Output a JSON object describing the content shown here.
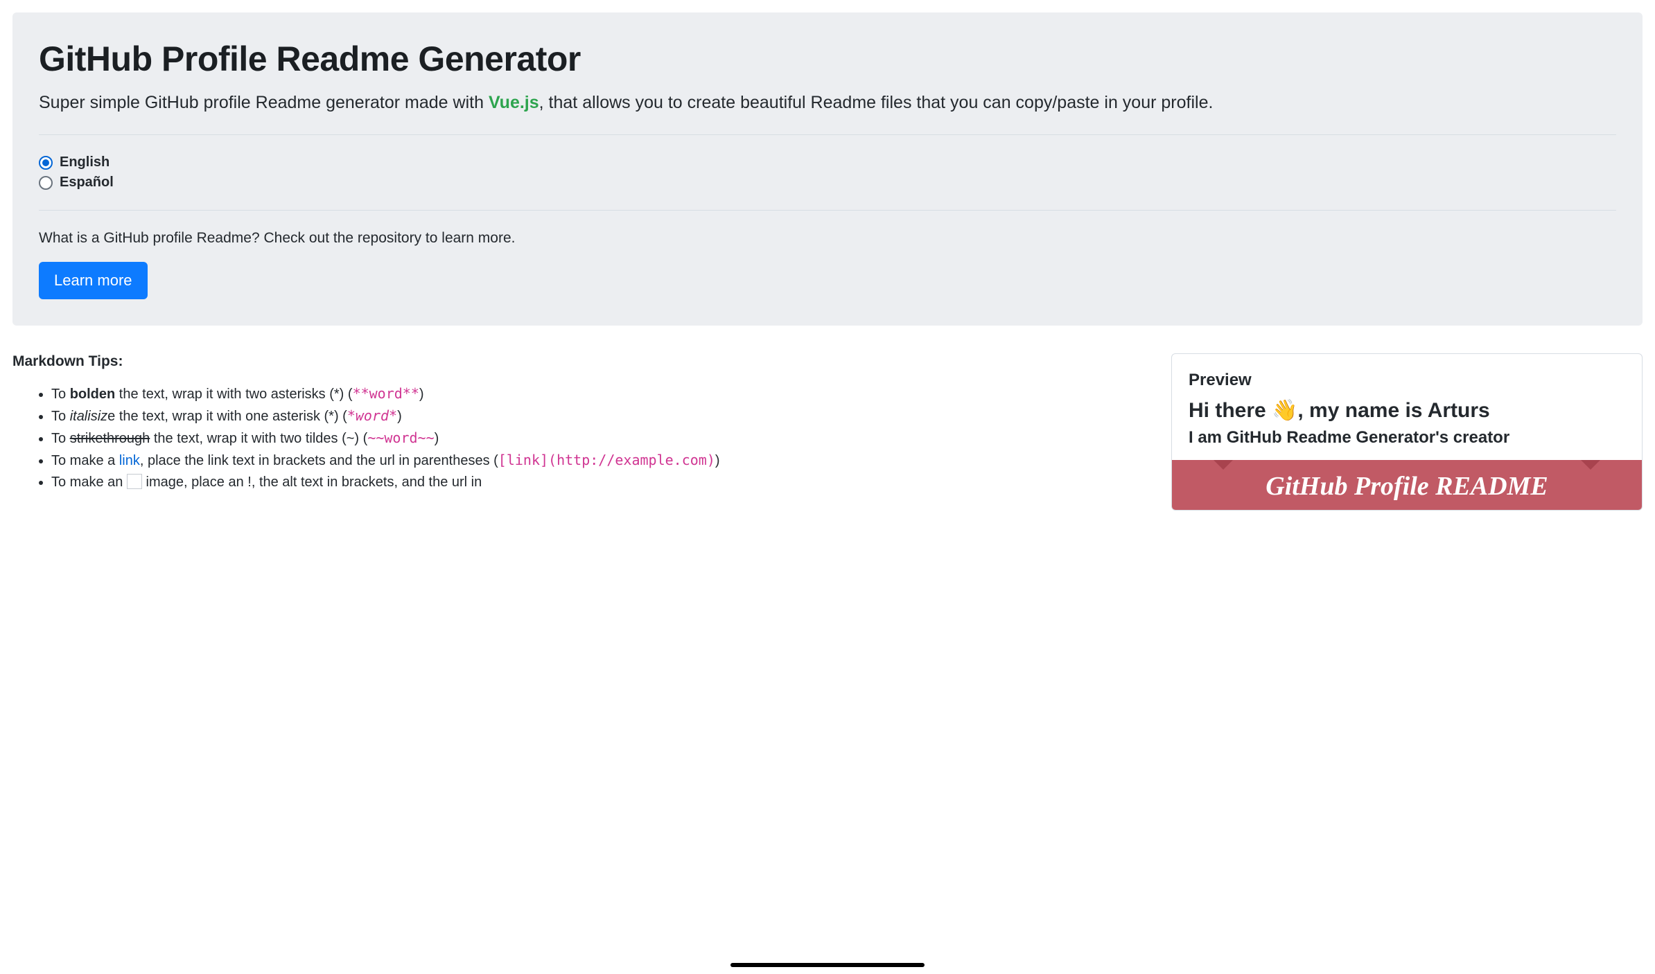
{
  "hero": {
    "title": "GitHub Profile Readme Generator",
    "subtitle_before": "Super simple GitHub profile Readme generator made with ",
    "vue": "Vue.js",
    "subtitle_after": ", that allows you to create beautiful Readme files that you can copy/paste in your profile.",
    "languages": [
      {
        "label": "English",
        "selected": true
      },
      {
        "label": "Español",
        "selected": false
      }
    ],
    "what_is": "What is a GitHub profile Readme? Check out the repository to learn more.",
    "learn_more": "Learn more"
  },
  "tips": {
    "title": "Markdown Tips:",
    "bold": {
      "pre": "To ",
      "word": "bolden",
      "mid": " the text, wrap it with two asterisks (*) (",
      "code": "**word**",
      "post": ")"
    },
    "italic": {
      "pre": "To ",
      "word": "italisiz",
      "word_end": "e",
      "mid": " the text, wrap it with one asterisk (*) (",
      "code": "*word*",
      "post": ")"
    },
    "strike": {
      "pre": "To ",
      "word": "strikethrough",
      "mid": " the text, wrap it with two tildes (~) (",
      "code": "~~word~~",
      "post": ")"
    },
    "link": {
      "pre": "To make a ",
      "word": "link",
      "mid": ", place the link text in brackets and the url in parentheses (",
      "code": "[link](http://example.com)",
      "post": ")"
    },
    "image": {
      "pre": "To make an ",
      "mid": " image, place an !, the alt text in brackets, and the url in"
    }
  },
  "preview": {
    "label": "Preview",
    "heading_before": "Hi there ",
    "wave": "👋",
    "heading_after": ", my name is Arturs",
    "sub": "I am GitHub Readme Generator's creator",
    "banner": "GitHub Profile README"
  }
}
